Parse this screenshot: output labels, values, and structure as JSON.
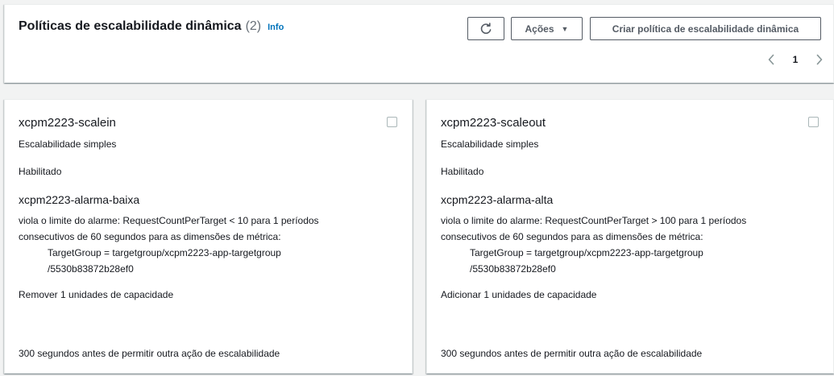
{
  "header": {
    "title": "Políticas de escalabilidade dinâmica",
    "count": "(2)",
    "info": "Info",
    "actions_label": "Ações",
    "create_label": "Criar política de escalabilidade dinâmica",
    "page": "1",
    "icons": {
      "refresh": "refresh-icon",
      "caret": "caret-down-icon",
      "prev": "chevron-left-icon",
      "next": "chevron-right-icon"
    }
  },
  "policies": [
    {
      "name": "xcpm2223-scalein",
      "type": "Escalabilidade simples",
      "status": "Habilitado",
      "alarm": "xcpm2223-alarma-baixa",
      "desc_line1": "viola o limite do alarme: RequestCountPerTarget < 10 para 1 períodos",
      "desc_line2": "consecutivos de 60 segundos para as dimensões de métrica:",
      "dim_line1": "TargetGroup = targetgroup/xcpm2223-app-targetgroup",
      "dim_line2": "/5530b83872b28ef0",
      "action": "Remover 1 unidades de capacidade",
      "cooldown": "300 segundos antes de permitir outra ação de escalabilidade"
    },
    {
      "name": "xcpm2223-scaleout",
      "type": "Escalabilidade simples",
      "status": "Habilitado",
      "alarm": "xcpm2223-alarma-alta",
      "desc_line1": "viola o limite do alarme: RequestCountPerTarget > 100 para 1 períodos",
      "desc_line2": "consecutivos de 60 segundos para as dimensões de métrica:",
      "dim_line1": "TargetGroup = targetgroup/xcpm2223-app-targetgroup",
      "dim_line2": "/5530b83872b28ef0",
      "action": "Adicionar 1 unidades de capacidade",
      "cooldown": "300 segundos antes de permitir outra ação de escalabilidade"
    }
  ],
  "colors": {
    "link": "#0073bb",
    "button_border": "#545b64",
    "background": "#f2f3f3"
  }
}
